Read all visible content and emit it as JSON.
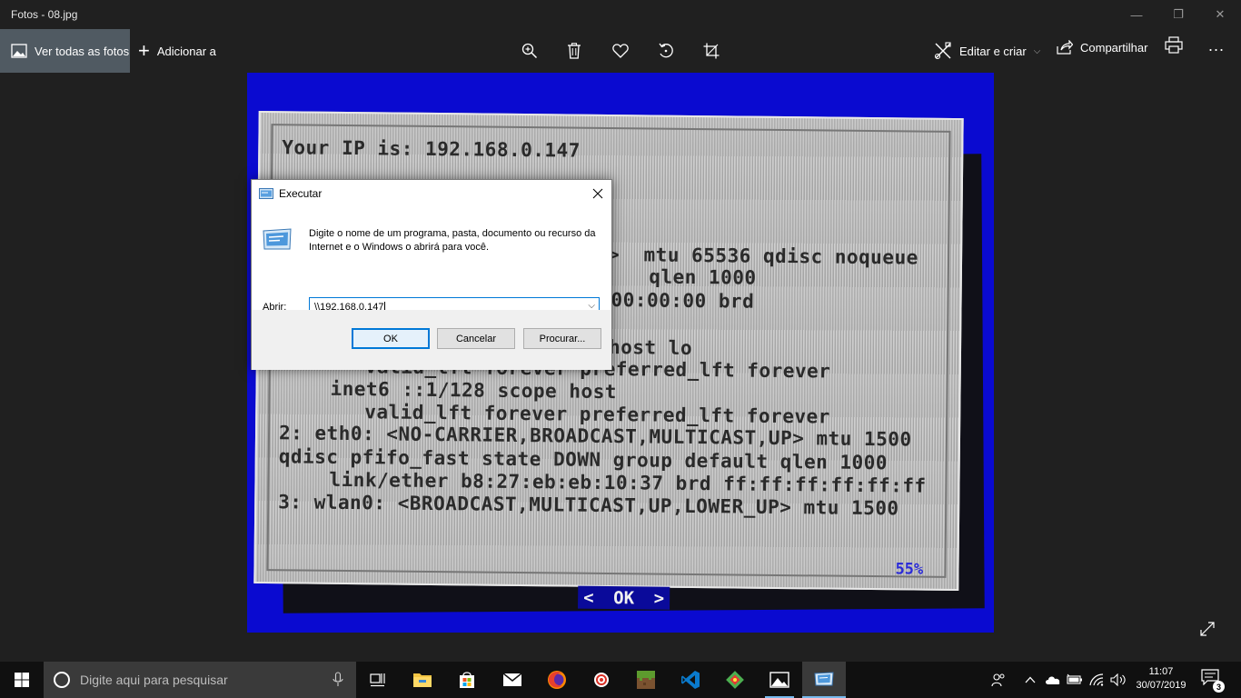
{
  "window": {
    "title": "Fotos - 08.jpg",
    "minimize": "—",
    "maximize": "❐",
    "close": "✕"
  },
  "toolbar": {
    "view_all": "Ver todas as fotos",
    "add_to": "Adicionar a",
    "edit_create": "Editar e criar",
    "share": "Compartilhar",
    "more": "..."
  },
  "photo": {
    "terminal_lines": [
      "Your IP is: 192.168.0.147",
      ">  mtu 65536 qdisc noqueue",
      "   qlen 1000",
      "00:00:00 brd",
      "host lo",
      "valid_lft forever preferred_lft forever",
      "inet6 ::1/128 scope host",
      "valid_lft forever preferred_lft forever",
      "2: eth0: <NO-CARRIER,BROADCAST,MULTICAST,UP> mtu 1500",
      "qdisc pfifo_fast state DOWN group default qlen 1000",
      "link/ether b8:27:eb:eb:10:37 brd ff:ff:ff:ff:ff:ff",
      "3: wlan0: <BROADCAST,MULTICAST,UP,LOWER_UP> mtu 1500"
    ],
    "percent": "55%",
    "ok_left": "<",
    "ok_label": "OK",
    "ok_right": ">"
  },
  "dialog": {
    "title": "Executar",
    "description": "Digite o nome de um programa, pasta, documento ou recurso da Internet e o Windows o abrirá para você.",
    "open_label": "Abrir:",
    "open_value": "\\\\192.168.0.147",
    "ok": "OK",
    "cancel": "Cancelar",
    "browse": "Procurar..."
  },
  "taskbar": {
    "search_placeholder": "Digite aqui para pesquisar",
    "time": "11:07",
    "date": "30/07/2019",
    "notification_count": "3",
    "accent": "#76b9ed"
  }
}
